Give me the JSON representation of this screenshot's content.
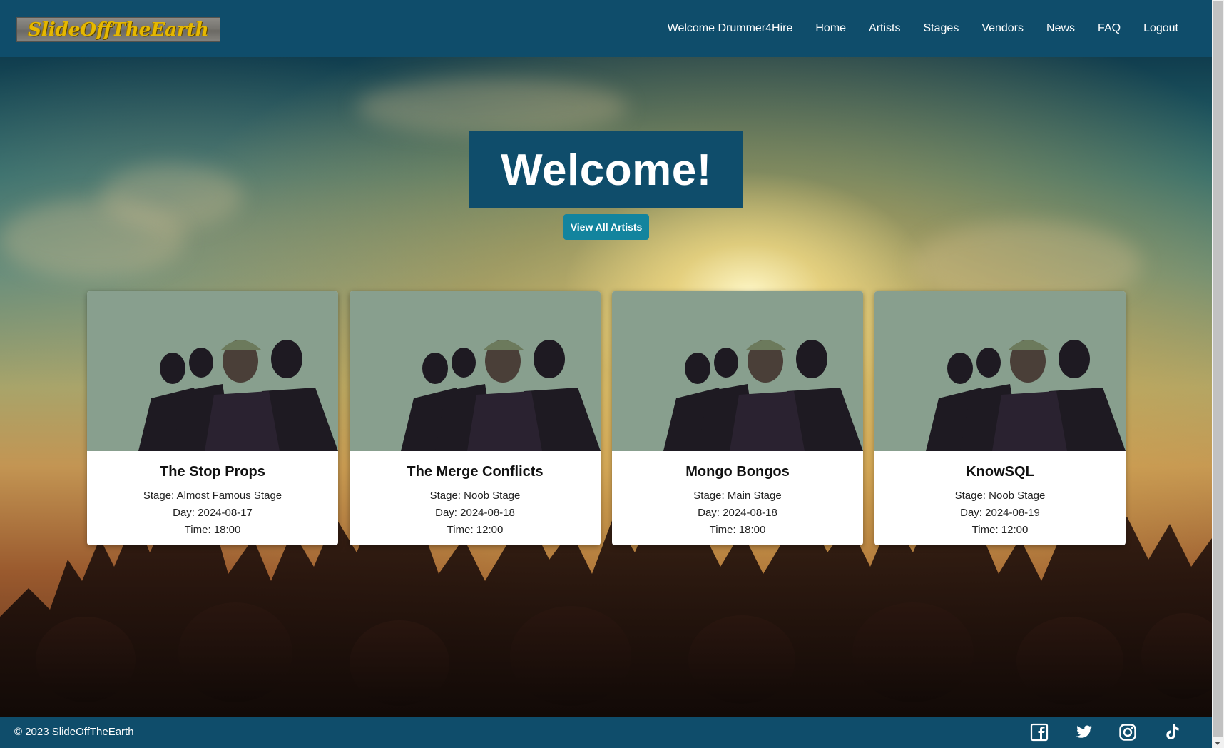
{
  "brand": {
    "logo_text": "SlideOffTheEarth"
  },
  "nav": {
    "welcome": "Welcome Drummer4Hire",
    "items": [
      "Home",
      "Artists",
      "Stages",
      "Vendors",
      "News",
      "FAQ",
      "Logout"
    ]
  },
  "hero": {
    "heading": "Welcome!",
    "button_label": "View All Artists"
  },
  "cards": [
    {
      "name": "The Stop Props",
      "stage": "Stage: Almost Famous Stage",
      "day": "Day: 2024-08-17",
      "time": "Time: 18:00"
    },
    {
      "name": "The Merge Conflicts",
      "stage": "Stage: Noob Stage",
      "day": "Day: 2024-08-18",
      "time": "Time: 12:00"
    },
    {
      "name": "Mongo Bongos",
      "stage": "Stage: Main Stage",
      "day": "Day: 2024-08-18",
      "time": "Time: 18:00"
    },
    {
      "name": "KnowSQL",
      "stage": "Stage: Noob Stage",
      "day": "Day: 2024-08-19",
      "time": "Time: 12:00"
    }
  ],
  "footer": {
    "copyright": "© 2023 SlideOffTheEarth",
    "socials": [
      "facebook-icon",
      "twitter-icon",
      "instagram-icon",
      "tiktok-icon"
    ]
  },
  "colors": {
    "nav_bg": "#0f4d6b",
    "button_bg": "#13849e",
    "card_bg": "#ffffff",
    "logo_text": "#e6b800"
  }
}
